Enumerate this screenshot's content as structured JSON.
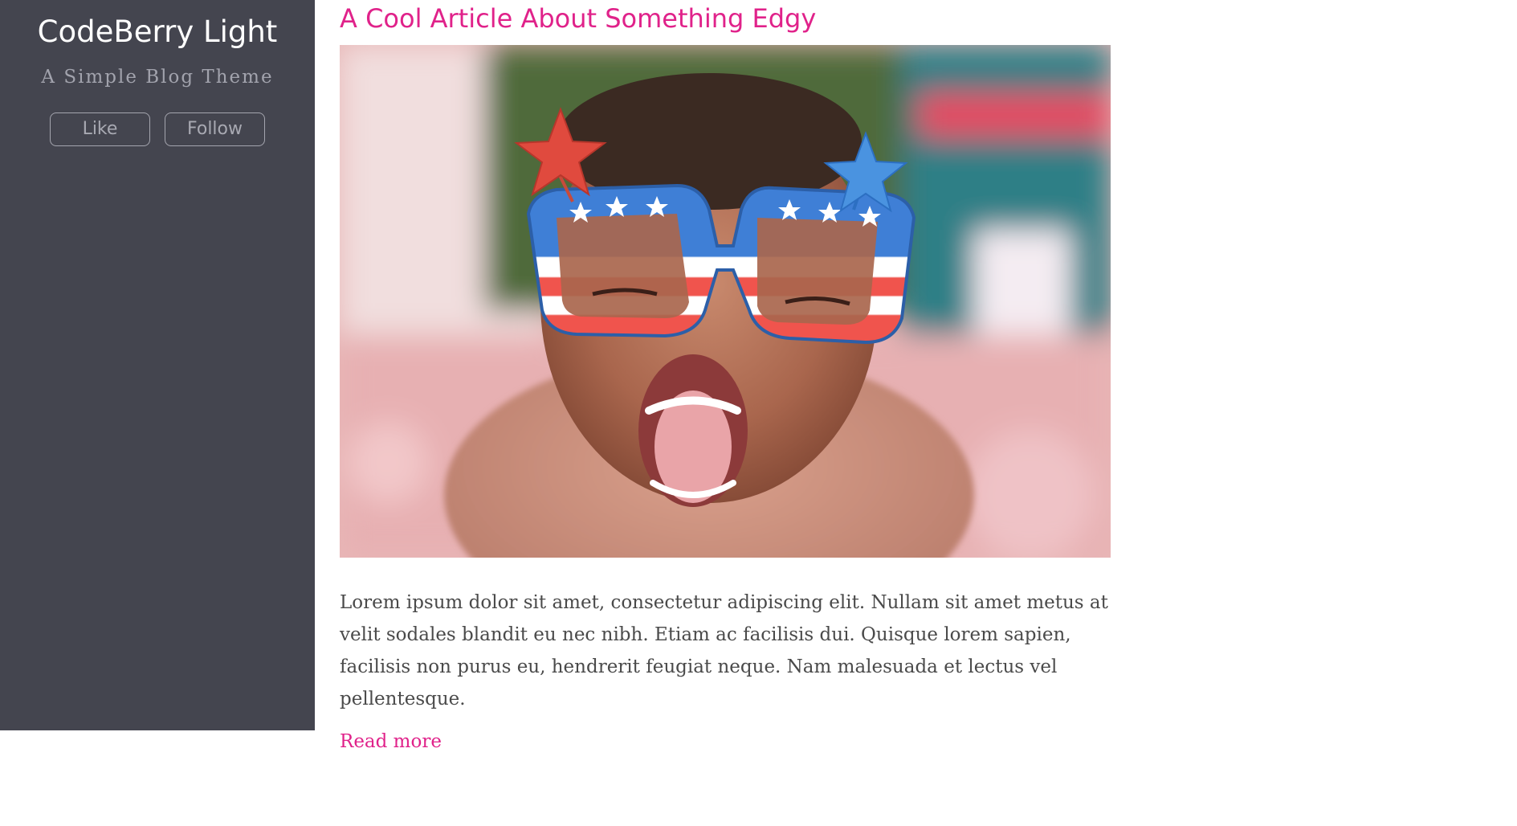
{
  "sidebar": {
    "blog_title": "CodeBerry Light",
    "blog_subtitle": "A Simple Blog Theme",
    "like_label": "Like",
    "follow_label": "Follow"
  },
  "article": {
    "title": "A Cool Article About Something Edgy",
    "excerpt": "Lorem ipsum dolor sit amet, consectetur adipiscing elit. Nullam sit amet metus at velit sodales blandit eu nec nibh. Etiam ac facilisis dui. Quisque lorem sapien, facilisis non purus eu, hendrerit feugiat neque. Nam malesuada et lectus vel pellentesque.",
    "read_more_label": "Read more"
  },
  "colors": {
    "sidebar_bg": "#44454f",
    "accent": "#e0228a",
    "body_text": "#4a4a4a"
  }
}
